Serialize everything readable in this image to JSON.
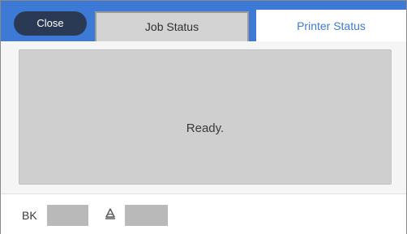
{
  "header": {
    "close_label": "Close",
    "tabs": [
      {
        "label": "Job Status",
        "selected": false
      },
      {
        "label": "Printer Status",
        "selected": true
      }
    ]
  },
  "status": {
    "message": "Ready."
  },
  "ink": {
    "label": "BK",
    "maintenance_icon": "maintenance-box-icon"
  },
  "colors": {
    "accent": "#3d7ad6",
    "close_button": "#2b3a54",
    "status_panel": "#cfcfcf"
  }
}
